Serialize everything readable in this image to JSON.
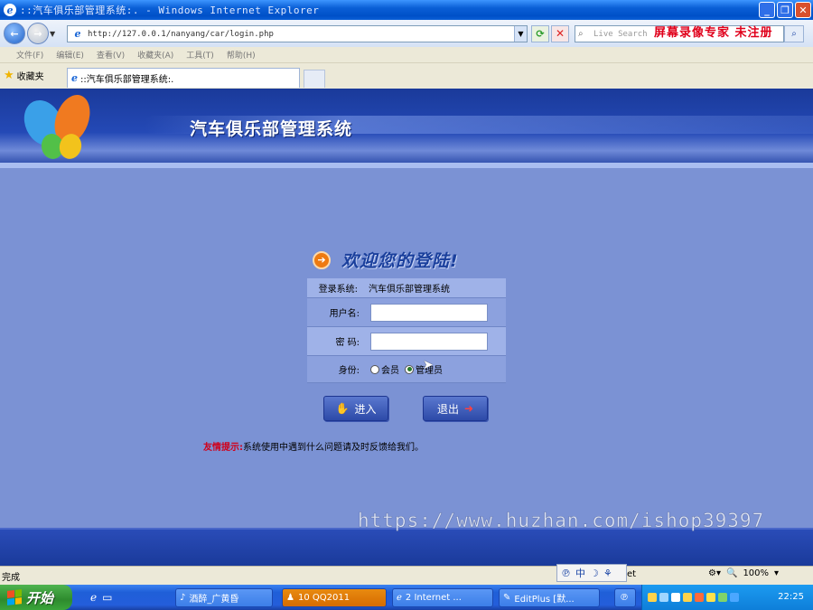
{
  "window": {
    "title": "::汽车俱乐部管理系统:. - Windows Internet Explorer"
  },
  "address_bar": {
    "url": "http://127.0.0.1/nanyang/car/login.php",
    "search_placeholder": "Live Search",
    "overlay_text": "屏幕录像专家 未注册"
  },
  "menu": {
    "items": [
      "文件(F)",
      "编辑(E)",
      "查看(V)",
      "收藏夹(A)",
      "工具(T)",
      "帮助(H)"
    ]
  },
  "tabs": {
    "favorites_label": "收藏夹",
    "active_tab_label": "::汽车俱乐部管理系统:."
  },
  "page": {
    "banner_title": "汽车俱乐部管理系统",
    "welcome": "欢迎您的登陆!",
    "form": {
      "system_label": "登录系统:",
      "system_value": "汽车俱乐部管理系统",
      "username_label": "用户名:",
      "username_value": "",
      "password_label": "密  码:",
      "password_value": "",
      "role_label": "身份:",
      "role_options": [
        "会员",
        "管理员"
      ],
      "role_selected": "管理员"
    },
    "buttons": {
      "enter": "进入",
      "exit": "退出"
    },
    "tip_label": "友情提示:",
    "tip_text": "系统使用中遇到什么问题请及时反馈给我们。",
    "watermark": "https://www.huzhan.com/ishop39397"
  },
  "statusbar": {
    "status": "完成",
    "ime": "中",
    "zone_fragment": "et",
    "zoom": "100%"
  },
  "taskbar": {
    "start": "开始",
    "tasks": [
      {
        "label": "酒醉_广黄昏"
      },
      {
        "label": "10 QQ2011"
      },
      {
        "label": "2 Internet ..."
      },
      {
        "label": "EditPlus [默..."
      }
    ],
    "clock": "22:25"
  },
  "colors": {
    "accent": "#2449b6",
    "page_bg": "#7b92d4",
    "tip_red": "#d0001b"
  }
}
